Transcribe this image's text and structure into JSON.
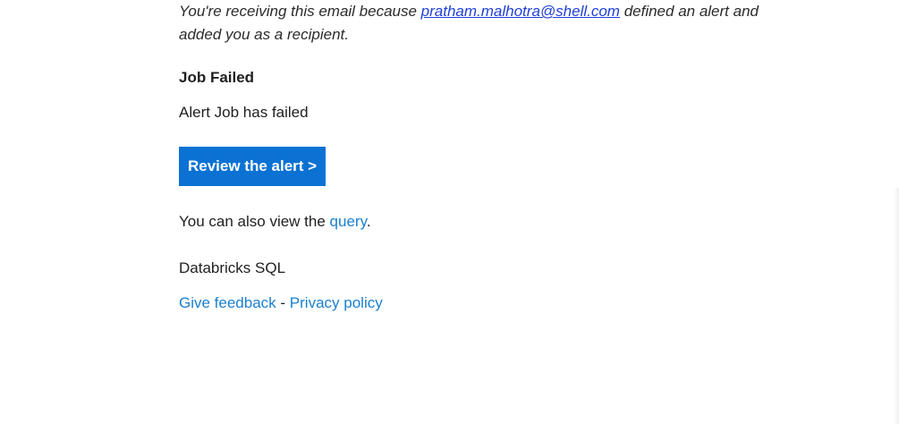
{
  "email": {
    "intro_prefix": "You're receiving this email because ",
    "intro_email": "pratham.malhotra@shell.com",
    "intro_suffix": " defined an alert and added you as a recipient.",
    "heading": "Job Failed",
    "message": "Alert Job has failed",
    "cta_label": "Review the alert >",
    "also_prefix": "You can also view the ",
    "also_link": "query",
    "also_suffix": ".",
    "brand": "Databricks SQL",
    "feedback_link": "Give feedback",
    "separator": " - ",
    "privacy_link": "Privacy policy"
  },
  "colors": {
    "accent_button": "#0b72d4",
    "link_blue": "#1a7fcf",
    "mailto_blue": "#1f3fd6"
  }
}
